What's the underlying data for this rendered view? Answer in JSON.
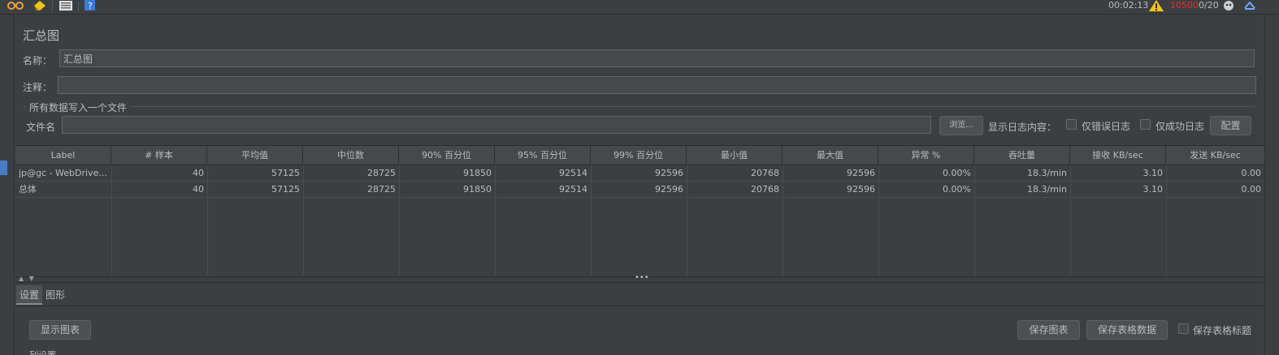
{
  "toolbar": {
    "icons": [
      "binoculars-icon",
      "clear-icon",
      "list-icon",
      "help-icon"
    ],
    "elapsed_time": "00:02:13",
    "warning_count": "10500",
    "threads": "0/20"
  },
  "panel": {
    "title": "汇总图",
    "name_label": "名称：",
    "name_value": "汇总图",
    "comment_label": "注释：",
    "comment_value": "",
    "file_group_title": "所有数据写入一个文件",
    "filename_label": "文件名",
    "filename_value": "",
    "browse_label": "浏览...",
    "log_content_label": "显示日志内容：",
    "errors_only_label": "仅错误日志",
    "success_only_label": "仅成功日志",
    "configure_label": "配置"
  },
  "table": {
    "columns": [
      "Label",
      "# 样本",
      "平均值",
      "中位数",
      "90% 百分位",
      "95% 百分位",
      "99% 百分位",
      "最小值",
      "最大值",
      "异常 %",
      "吞吐量",
      "接收 KB/sec",
      "发送 KB/sec"
    ],
    "rows": [
      [
        "jp@gc - WebDrive...",
        "40",
        "57125",
        "28725",
        "91850",
        "92514",
        "92596",
        "20768",
        "92596",
        "0.00%",
        "18.3/min",
        "3.10",
        "0.00"
      ],
      [
        "总体",
        "40",
        "57125",
        "28725",
        "91850",
        "92514",
        "92596",
        "20768",
        "92596",
        "0.00%",
        "18.3/min",
        "3.10",
        "0.00"
      ]
    ]
  },
  "tabs": {
    "settings": "设置",
    "graph": "图形"
  },
  "bottom": {
    "show_chart_label": "显示图表",
    "save_chart_label": "保存图表",
    "save_table_label": "保存表格数据",
    "save_header_label": "保存表格标题",
    "cut_text": "列设置"
  },
  "colors": {
    "background": "#3c3f41",
    "field": "#45494a",
    "text": "#bbbbbb",
    "warning_count": "#e03030",
    "selection_marker": "#4a7bc6"
  }
}
